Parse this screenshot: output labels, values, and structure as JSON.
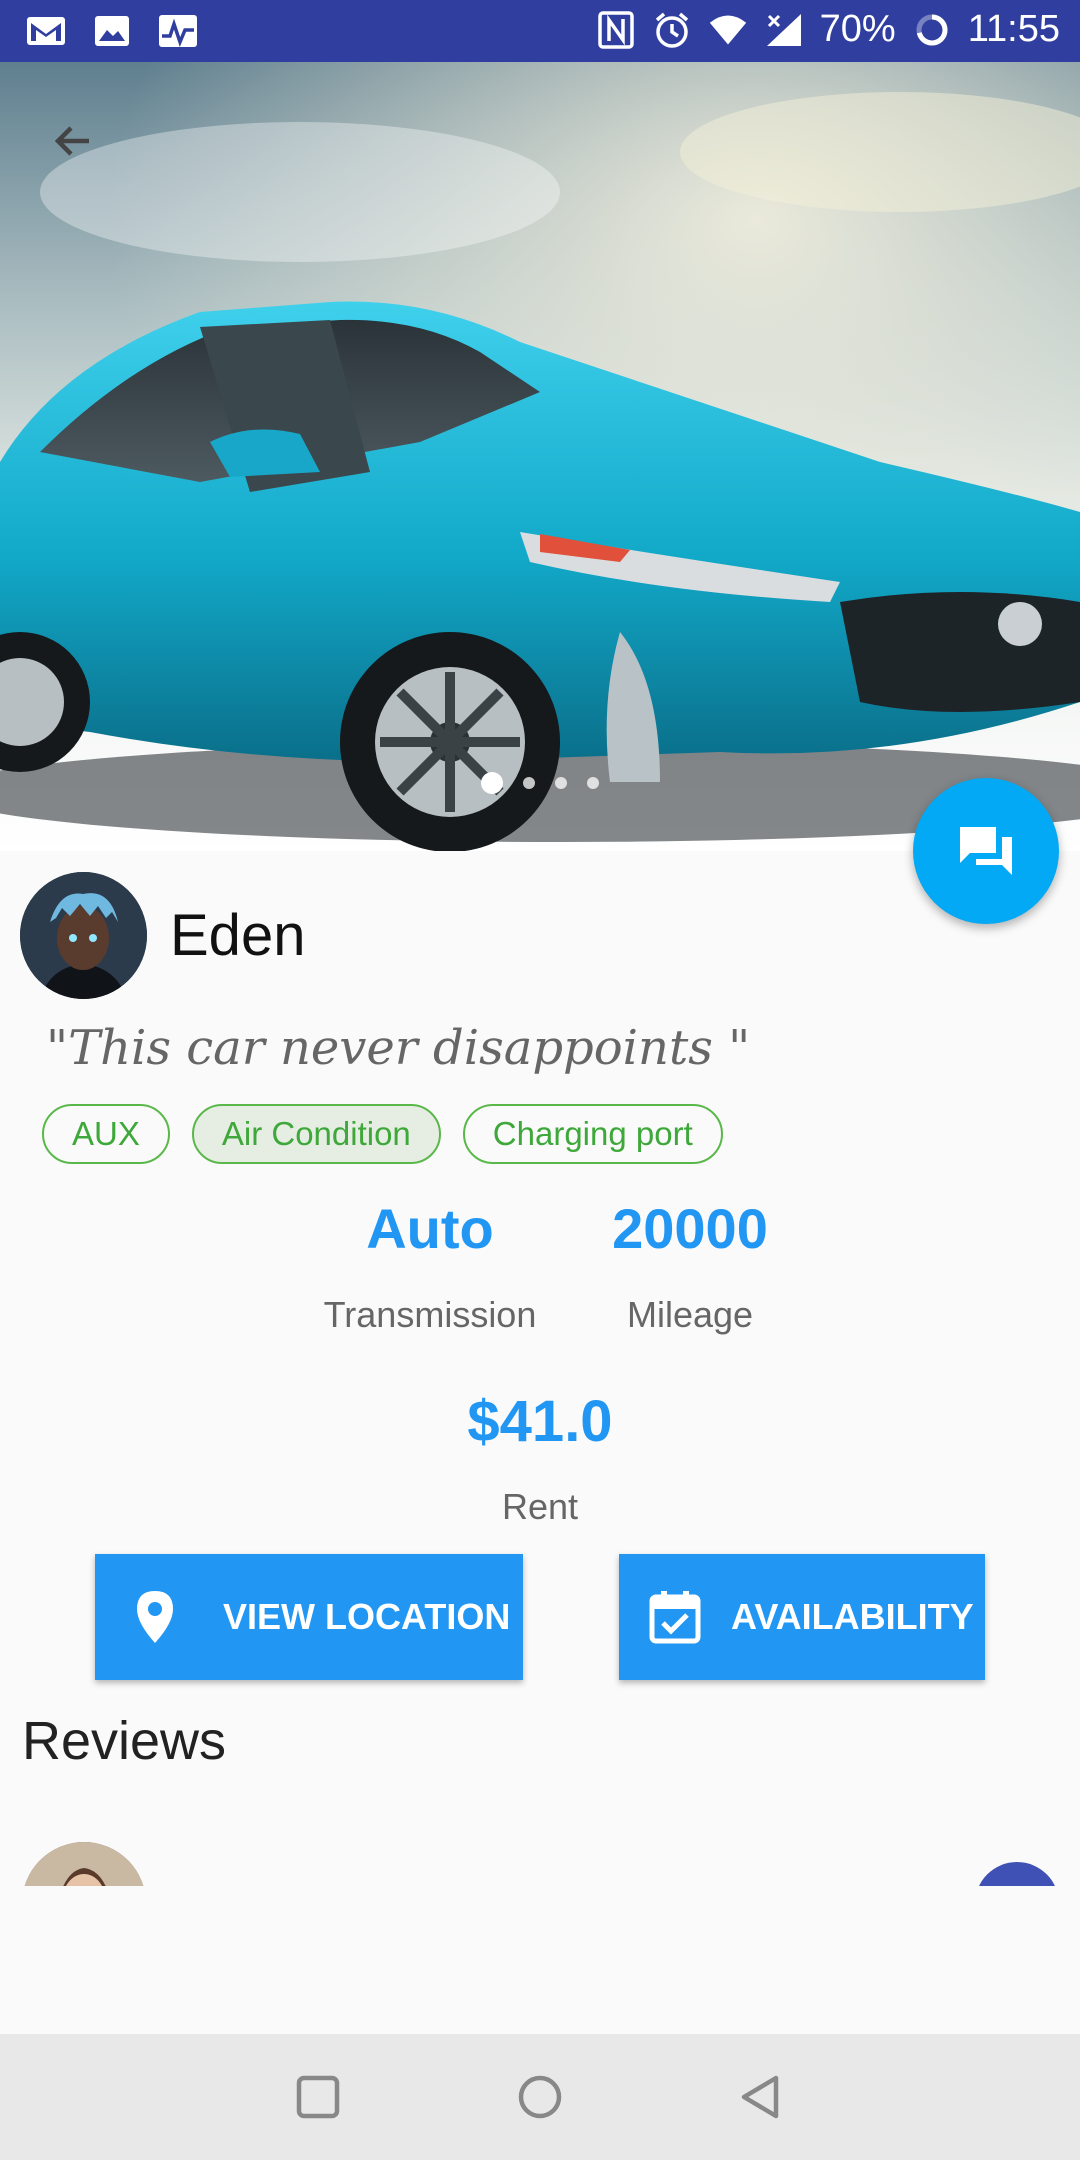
{
  "status_bar": {
    "left_icons": [
      "gmail-icon",
      "gallery-icon",
      "activity-icon"
    ],
    "right_icons": [
      "nfc-icon",
      "alarm-icon",
      "wifi-icon",
      "signal-icon"
    ],
    "battery": "70%",
    "time": "11:55"
  },
  "hero": {
    "slide_count": 4,
    "active_slide": 1
  },
  "owner": {
    "name": "Eden",
    "quote": "\"This car never disappoints \""
  },
  "features": [
    {
      "label": "AUX",
      "selected": false
    },
    {
      "label": "Air Condition",
      "selected": true
    },
    {
      "label": "Charging port",
      "selected": false
    }
  ],
  "specs": {
    "transmission": {
      "value": "Auto",
      "label": "Transmission"
    },
    "mileage": {
      "value": "20000",
      "label": "Mileage"
    }
  },
  "rent": {
    "value": "$41.0",
    "label": "Rent"
  },
  "buttons": {
    "view_location": "VIEW LOCATION",
    "availability": "AVAILABILITY"
  },
  "reviews": {
    "title": "Reviews"
  },
  "colors": {
    "status_bar": "#303f9f",
    "accent": "#2196f3",
    "fab": "#03a9f4",
    "chip": "#3fa83a",
    "review_fab": "#3f51b5"
  }
}
